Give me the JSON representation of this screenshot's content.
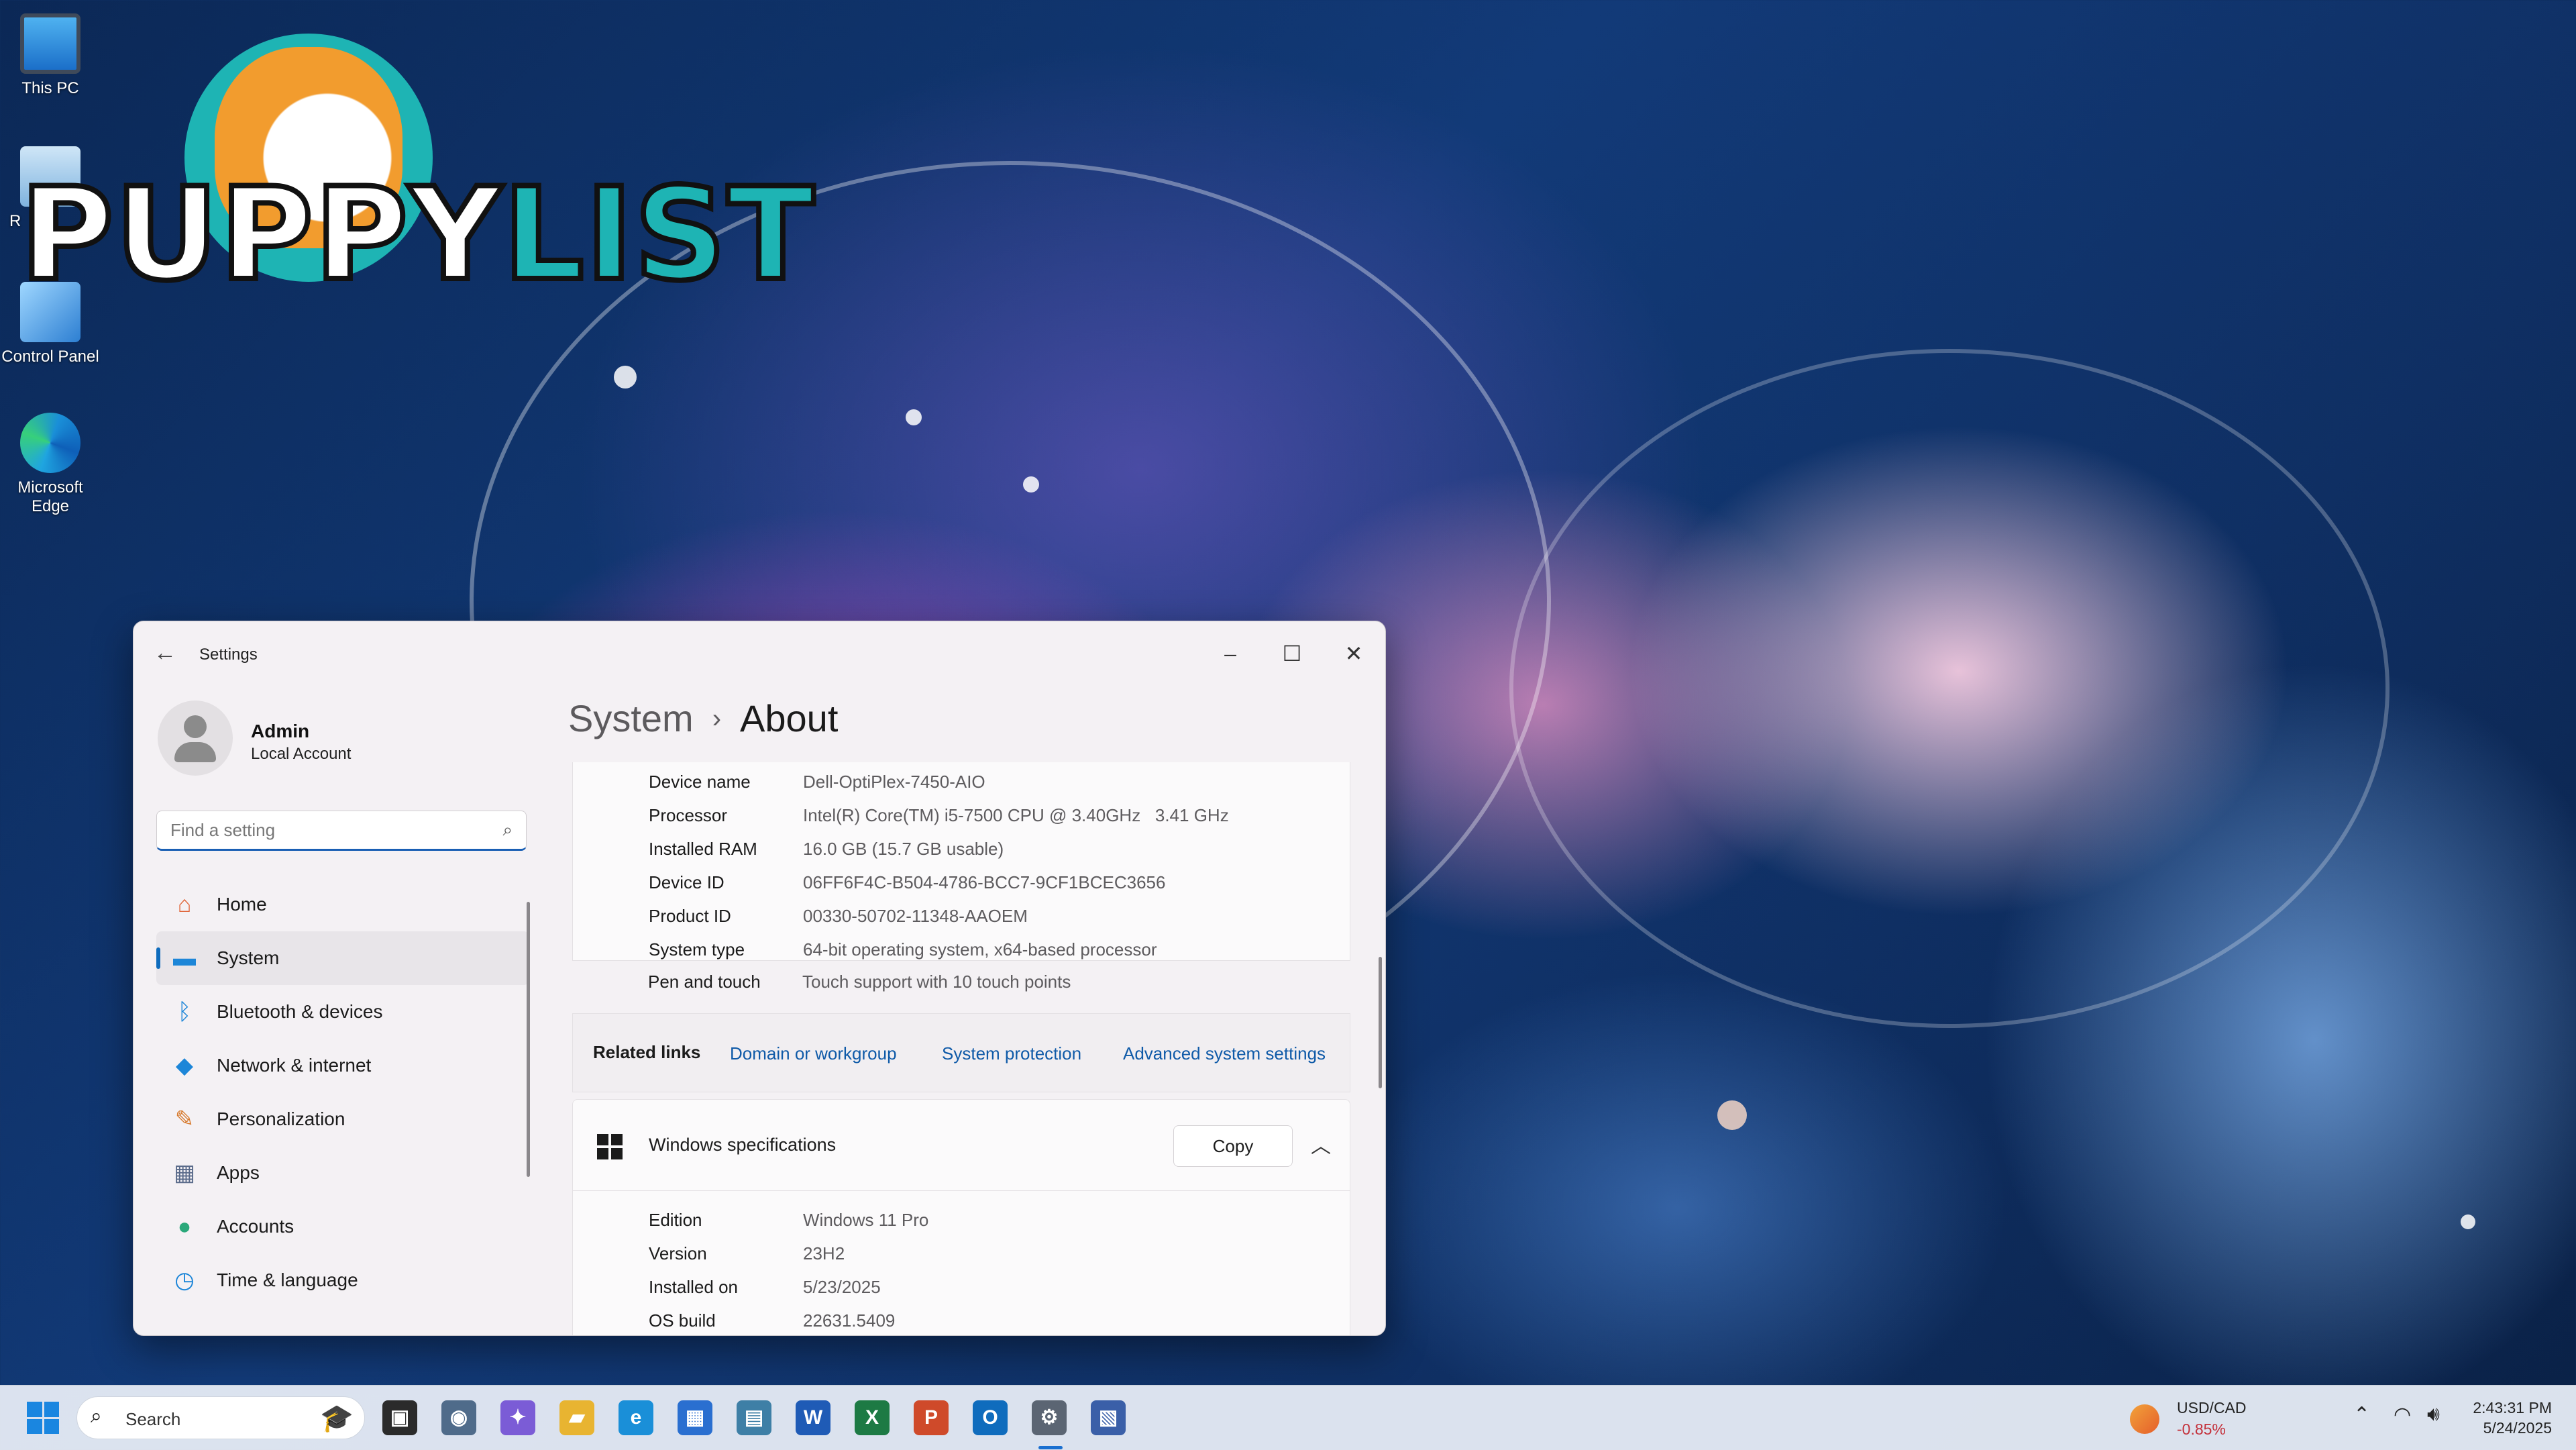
{
  "desktop": {
    "icons": [
      {
        "label": "This PC"
      },
      {
        "label": "R"
      },
      {
        "label": "Control Panel"
      },
      {
        "label": "Microsoft Edge"
      }
    ],
    "logo": {
      "text_white": "PUPPY",
      "text_teal": "LIST"
    }
  },
  "settings": {
    "window_title": "Settings",
    "user": {
      "name": "Admin",
      "account_type": "Local Account"
    },
    "search_placeholder": "Find a setting",
    "nav": [
      {
        "label": "Home",
        "icon": "home-icon"
      },
      {
        "label": "System",
        "icon": "system-icon",
        "active": true
      },
      {
        "label": "Bluetooth & devices",
        "icon": "bluetooth-icon"
      },
      {
        "label": "Network & internet",
        "icon": "wifi-icon"
      },
      {
        "label": "Personalization",
        "icon": "brush-icon"
      },
      {
        "label": "Apps",
        "icon": "apps-icon"
      },
      {
        "label": "Accounts",
        "icon": "person-icon"
      },
      {
        "label": "Time & language",
        "icon": "globe-clock-icon"
      }
    ],
    "breadcrumb": {
      "parent": "System",
      "separator": "›",
      "current": "About"
    },
    "device_specs": [
      {
        "label": "Device name",
        "value": "Dell-OptiPlex-7450-AIO"
      },
      {
        "label": "Processor",
        "value": "Intel(R) Core(TM) i5-7500 CPU @ 3.40GHz   3.41 GHz"
      },
      {
        "label": "Installed RAM",
        "value": "16.0 GB (15.7 GB usable)"
      },
      {
        "label": "Device ID",
        "value": "06FF6F4C-B504-4786-BCC7-9CF1BCEC3656"
      },
      {
        "label": "Product ID",
        "value": "00330-50702-11348-AAOEM"
      },
      {
        "label": "System type",
        "value": "64-bit operating system, x64-based processor"
      },
      {
        "label": "Pen and touch",
        "value": "Touch support with 10 touch points"
      }
    ],
    "related_links": {
      "label": "Related links",
      "links": [
        "Domain or workgroup",
        "System protection",
        "Advanced system settings"
      ]
    },
    "windows_specs": {
      "title": "Windows specifications",
      "copy_label": "Copy",
      "rows": [
        {
          "label": "Edition",
          "value": "Windows 11 Pro"
        },
        {
          "label": "Version",
          "value": "23H2"
        },
        {
          "label": "Installed on",
          "value": "5/23/2025"
        },
        {
          "label": "OS build",
          "value": "22631.5409"
        }
      ]
    }
  },
  "taskbar": {
    "search_label": "Search",
    "apps": [
      {
        "name": "task-view",
        "glyph": "▣",
        "color": "#2b2b2b"
      },
      {
        "name": "camera",
        "glyph": "◉",
        "color": "#4f6b8a"
      },
      {
        "name": "copilot",
        "glyph": "✦",
        "color": "#7b5cd6"
      },
      {
        "name": "file-explorer",
        "glyph": "▰",
        "color": "#e8b431"
      },
      {
        "name": "edge",
        "glyph": "e",
        "color": "#1a8fd8"
      },
      {
        "name": "store",
        "glyph": "▦",
        "color": "#2a6fd0"
      },
      {
        "name": "remote",
        "glyph": "▤",
        "color": "#3e7fa6"
      },
      {
        "name": "word",
        "glyph": "W",
        "color": "#1f5bb6"
      },
      {
        "name": "excel",
        "glyph": "X",
        "color": "#1d7a44"
      },
      {
        "name": "powerpoint",
        "glyph": "P",
        "color": "#cf4a2a"
      },
      {
        "name": "outlook",
        "glyph": "O",
        "color": "#0f6cbd"
      },
      {
        "name": "settings",
        "glyph": "⚙",
        "color": "#5b6573"
      },
      {
        "name": "system-info",
        "glyph": "▧",
        "color": "#3a5fa8"
      }
    ],
    "ticker": {
      "pair": "USD/CAD",
      "change": "-0.85%"
    },
    "clock": {
      "time": "2:43:31 PM",
      "date": "5/24/2025"
    }
  }
}
